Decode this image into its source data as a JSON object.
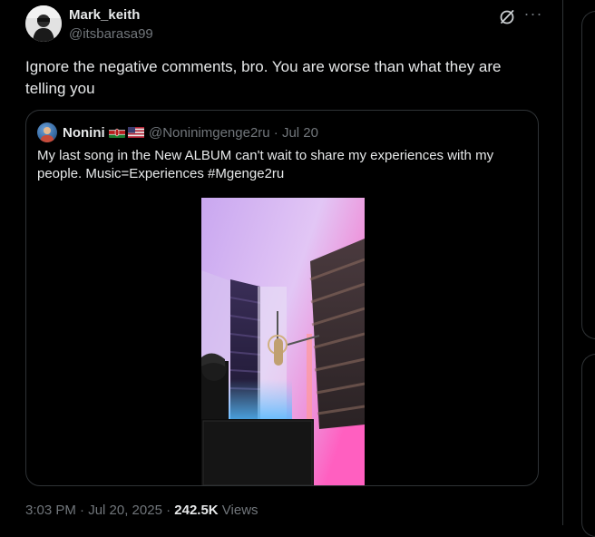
{
  "author": {
    "name": "Mark_keith",
    "handle": "@itsbarasa99"
  },
  "icons": {
    "grok": "grok-icon",
    "more": "more-icon",
    "more_glyph": "···"
  },
  "tweet": {
    "text": "Ignore the negative comments, bro. You are worse than what they are telling you"
  },
  "quoted": {
    "name": "Nonini",
    "flags": [
      "kenya-flag",
      "us-flag"
    ],
    "handle_date": "@Noninimgenge2ru · Jul 20",
    "text": "My last song in the New ALBUM can't wait to share my experiences with my people. Music=Experiences #Mgenge2ru"
  },
  "meta": {
    "time_date": "3:03 PM · Jul 20, 2025 · ",
    "views_count": "242.5K",
    "views_label": " Views"
  },
  "colors": {
    "background": "#000000",
    "text": "#e7e9ea",
    "muted": "#71767b",
    "border": "#2f3336"
  }
}
